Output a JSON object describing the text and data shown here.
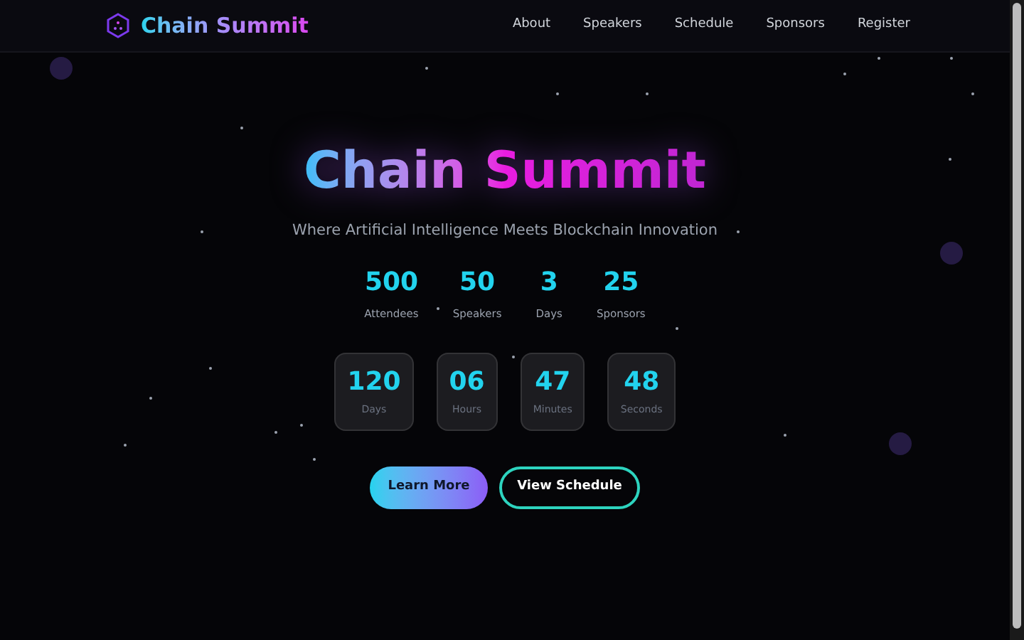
{
  "brand": "Chain Summit",
  "nav": [
    "About",
    "Speakers",
    "Schedule",
    "Sponsors",
    "Register"
  ],
  "hero": {
    "title": "Chain Summit",
    "subtitle": "Where Artificial Intelligence Meets Blockchain Innovation"
  },
  "stats": [
    {
      "value": "500",
      "label": "Attendees"
    },
    {
      "value": "50",
      "label": "Speakers"
    },
    {
      "value": "3",
      "label": "Days"
    },
    {
      "value": "25",
      "label": "Sponsors"
    }
  ],
  "countdown": [
    {
      "value": "120",
      "label": "Days"
    },
    {
      "value": "06",
      "label": "Hours"
    },
    {
      "value": "47",
      "label": "Minutes"
    },
    {
      "value": "48",
      "label": "Seconds"
    }
  ],
  "buttons": [
    {
      "label": "Learn More",
      "kind": "primary"
    },
    {
      "label": "View Schedule",
      "kind": "outline"
    }
  ]
}
